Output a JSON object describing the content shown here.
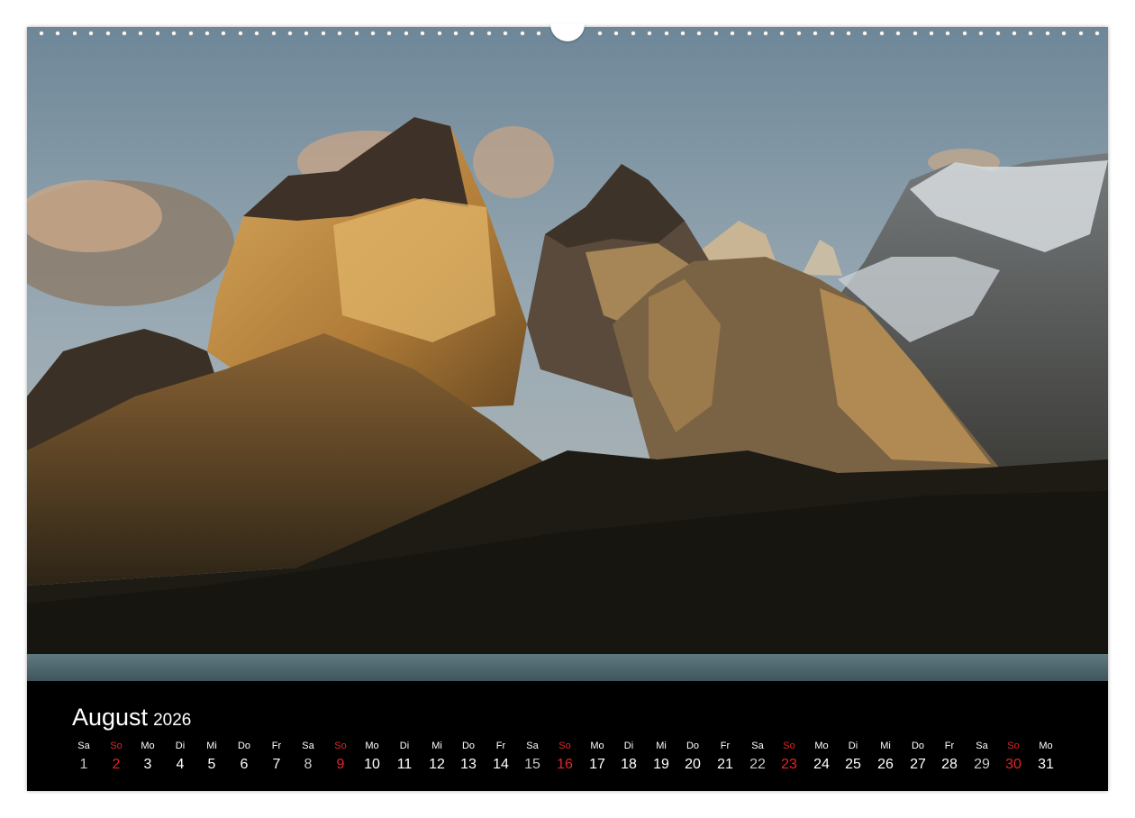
{
  "calendar": {
    "month": "August",
    "year": "2026",
    "days": [
      {
        "name": "Sa",
        "num": "1",
        "kind": "sat"
      },
      {
        "name": "So",
        "num": "2",
        "kind": "sun"
      },
      {
        "name": "Mo",
        "num": "3",
        "kind": "wd"
      },
      {
        "name": "Di",
        "num": "4",
        "kind": "wd"
      },
      {
        "name": "Mi",
        "num": "5",
        "kind": "wd"
      },
      {
        "name": "Do",
        "num": "6",
        "kind": "wd"
      },
      {
        "name": "Fr",
        "num": "7",
        "kind": "wd"
      },
      {
        "name": "Sa",
        "num": "8",
        "kind": "sat"
      },
      {
        "name": "So",
        "num": "9",
        "kind": "sun"
      },
      {
        "name": "Mo",
        "num": "10",
        "kind": "wd"
      },
      {
        "name": "Di",
        "num": "11",
        "kind": "wd"
      },
      {
        "name": "Mi",
        "num": "12",
        "kind": "wd"
      },
      {
        "name": "Do",
        "num": "13",
        "kind": "wd"
      },
      {
        "name": "Fr",
        "num": "14",
        "kind": "wd"
      },
      {
        "name": "Sa",
        "num": "15",
        "kind": "sat"
      },
      {
        "name": "So",
        "num": "16",
        "kind": "sun"
      },
      {
        "name": "Mo",
        "num": "17",
        "kind": "wd"
      },
      {
        "name": "Di",
        "num": "18",
        "kind": "wd"
      },
      {
        "name": "Mi",
        "num": "19",
        "kind": "wd"
      },
      {
        "name": "Do",
        "num": "20",
        "kind": "wd"
      },
      {
        "name": "Fr",
        "num": "21",
        "kind": "wd"
      },
      {
        "name": "Sa",
        "num": "22",
        "kind": "sat"
      },
      {
        "name": "So",
        "num": "23",
        "kind": "sun"
      },
      {
        "name": "Mo",
        "num": "24",
        "kind": "wd"
      },
      {
        "name": "Di",
        "num": "25",
        "kind": "wd"
      },
      {
        "name": "Mi",
        "num": "26",
        "kind": "wd"
      },
      {
        "name": "Do",
        "num": "27",
        "kind": "wd"
      },
      {
        "name": "Fr",
        "num": "28",
        "kind": "wd"
      },
      {
        "name": "Sa",
        "num": "29",
        "kind": "sat"
      },
      {
        "name": "So",
        "num": "30",
        "kind": "sun"
      },
      {
        "name": "Mo",
        "num": "31",
        "kind": "wd"
      }
    ]
  },
  "colors": {
    "sunday": "#e0262b",
    "saturday": "#c8c8c8",
    "weekday": "#ffffff",
    "footer_bg": "#000000"
  }
}
